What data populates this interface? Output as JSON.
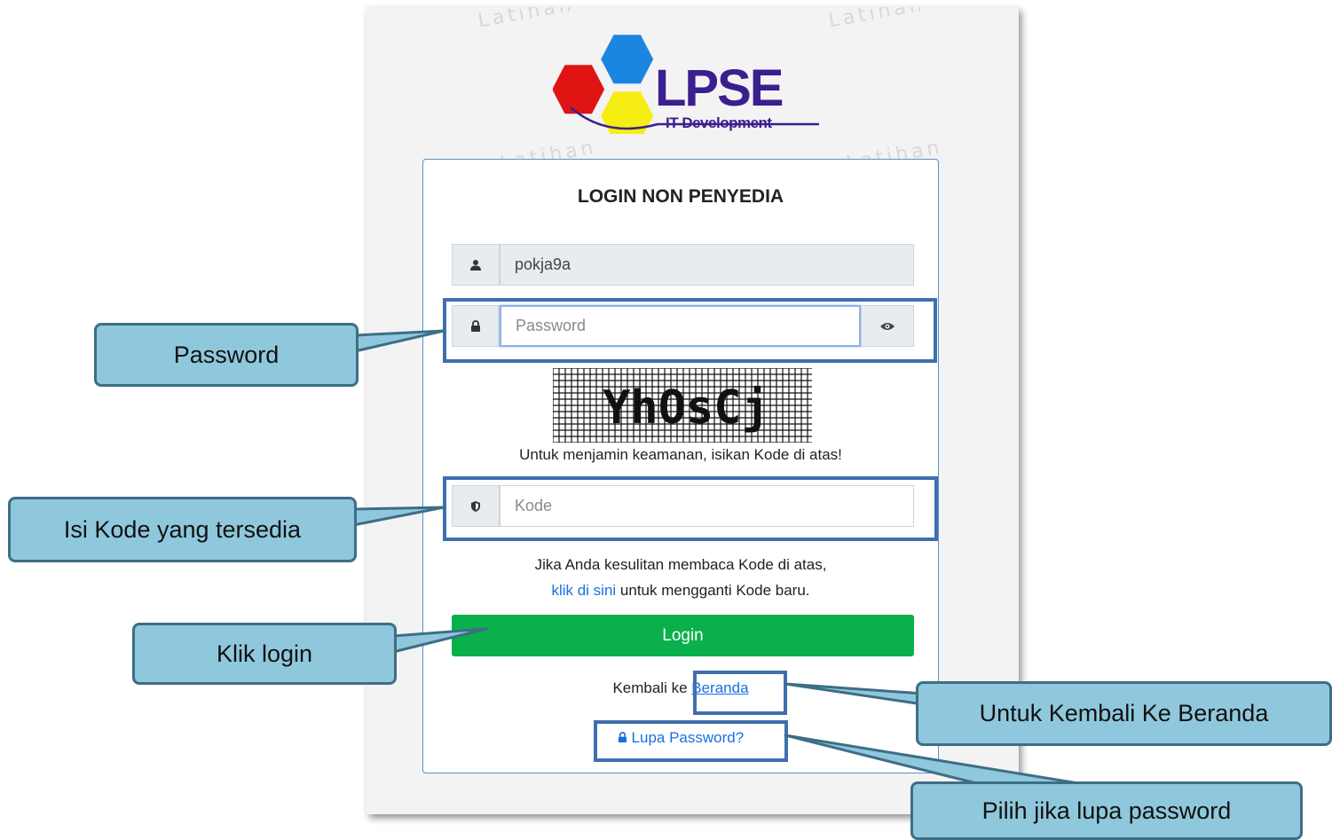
{
  "watermark": "Latihan",
  "logo": {
    "brand": "LPSE",
    "sub": "IT Development"
  },
  "card": {
    "title": "LOGIN NON PENYEDIA",
    "username_value": "pokja9a",
    "password_placeholder": "Password",
    "captcha_text": "YhOsCj",
    "captcha_hint": "Untuk menjamin keamanan, isikan Kode di atas!",
    "code_placeholder": "Kode",
    "help_line1": "Jika Anda kesulitan membaca Kode di atas,",
    "help_link": "klik di sini",
    "help_line2_rest": " untuk mengganti Kode baru.",
    "login_label": "Login",
    "back_prefix": "Kembali ke ",
    "back_link": "Beranda",
    "forgot_label": "Lupa Password?"
  },
  "callouts": {
    "password": "Password",
    "code": "Isi Kode yang tersedia",
    "login": "Klik login",
    "home": "Untuk Kembali Ke Beranda",
    "forgot": "Pilih jika lupa password"
  },
  "colors": {
    "accent": "#0ab04b",
    "link": "#1a6fe0",
    "callout_fill": "#8fc8dc",
    "highlight": "#3f6fae"
  }
}
